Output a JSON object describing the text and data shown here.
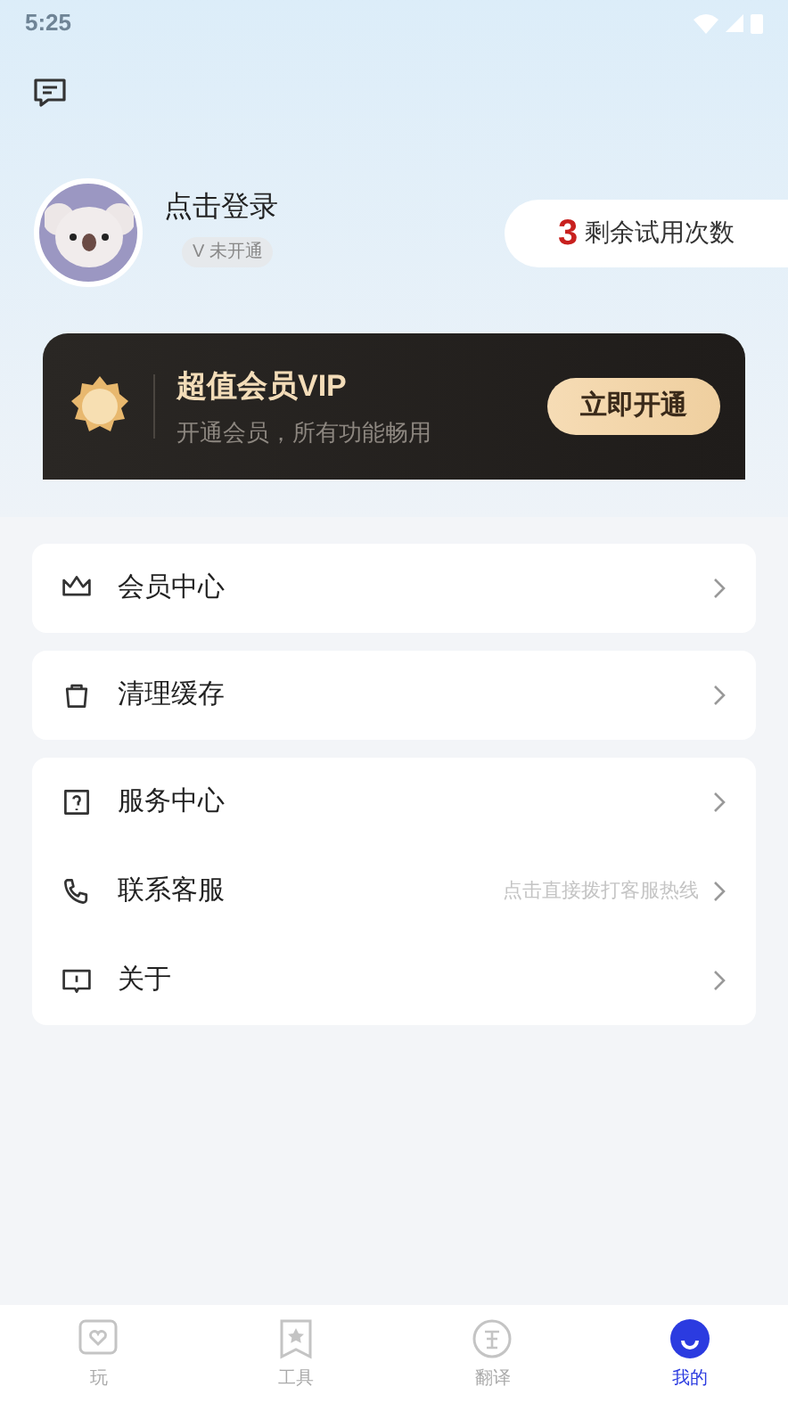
{
  "status_bar": {
    "time": "5:25"
  },
  "profile": {
    "name": "点击登录",
    "vip_badge": "V 未开通",
    "trial_count": "3",
    "trial_label": "剩余试用次数"
  },
  "vip_card": {
    "title": "超值会员VIP",
    "subtitle": "开通会员，所有功能畅用",
    "button": "立即开通"
  },
  "menu_groups": [
    [
      {
        "kind": "crown",
        "label": "会员中心"
      }
    ],
    [
      {
        "kind": "bag",
        "label": "清理缓存"
      }
    ],
    [
      {
        "kind": "question",
        "label": "服务中心"
      },
      {
        "kind": "phone",
        "label": "联系客服",
        "hint": "点击直接拨打客服热线"
      },
      {
        "kind": "info",
        "label": "关于"
      }
    ]
  ],
  "tabs": [
    {
      "kind": "heart",
      "label": "玩",
      "selected": false
    },
    {
      "kind": "star",
      "label": "工具",
      "selected": false
    },
    {
      "kind": "translate",
      "label": "翻译",
      "selected": false
    },
    {
      "kind": "me",
      "label": "我的",
      "selected": true
    }
  ]
}
